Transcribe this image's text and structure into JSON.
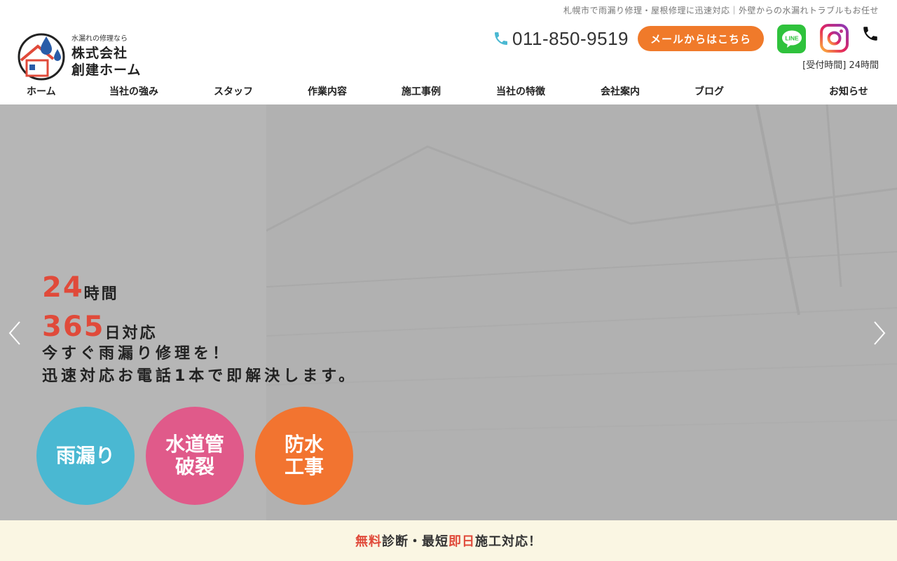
{
  "header": {
    "tagline": "札幌市で雨漏り修理・屋根修理に迅速対応｜外壁からの水漏れトラブルもお任せ",
    "logo_small": "水漏れの修理なら",
    "logo_line1": "株式会社",
    "logo_line2": "創建ホーム",
    "phone": "011-850-9519",
    "mail_button": "メールからはこちら",
    "hours": "[受付時間] 24時間"
  },
  "nav": [
    {
      "label": "ホーム"
    },
    {
      "label": "当社の強み"
    },
    {
      "label": "スタッフ"
    },
    {
      "label": "作業内容"
    },
    {
      "label": "施工事例"
    },
    {
      "label": "当社の特徴"
    },
    {
      "label": "会社案内"
    },
    {
      "label": "ブログ"
    },
    {
      "label": "お知らせ"
    }
  ],
  "hero": {
    "num1": "24",
    "unit1": "時間",
    "num2": "365",
    "unit2": "日対応",
    "line1": "今すぐ雨漏り修理を！",
    "line2": "迅速対応お電話1本で即解決します。",
    "circles": [
      {
        "label": "雨漏り"
      },
      {
        "label": "水道管\n破裂"
      },
      {
        "label": "防水\n工事"
      }
    ]
  },
  "footer": {
    "part1": "無料",
    "part2": "診断・最短",
    "part3": "即日",
    "part4": "施工対応！"
  },
  "colors": {
    "accent_orange": "#f07a2a",
    "accent_red": "#e04a3a",
    "circle_blue": "#4ab8d2",
    "circle_pink": "#e05a8a",
    "circle_orange": "#f27430",
    "line_green": "#2fc23c"
  }
}
